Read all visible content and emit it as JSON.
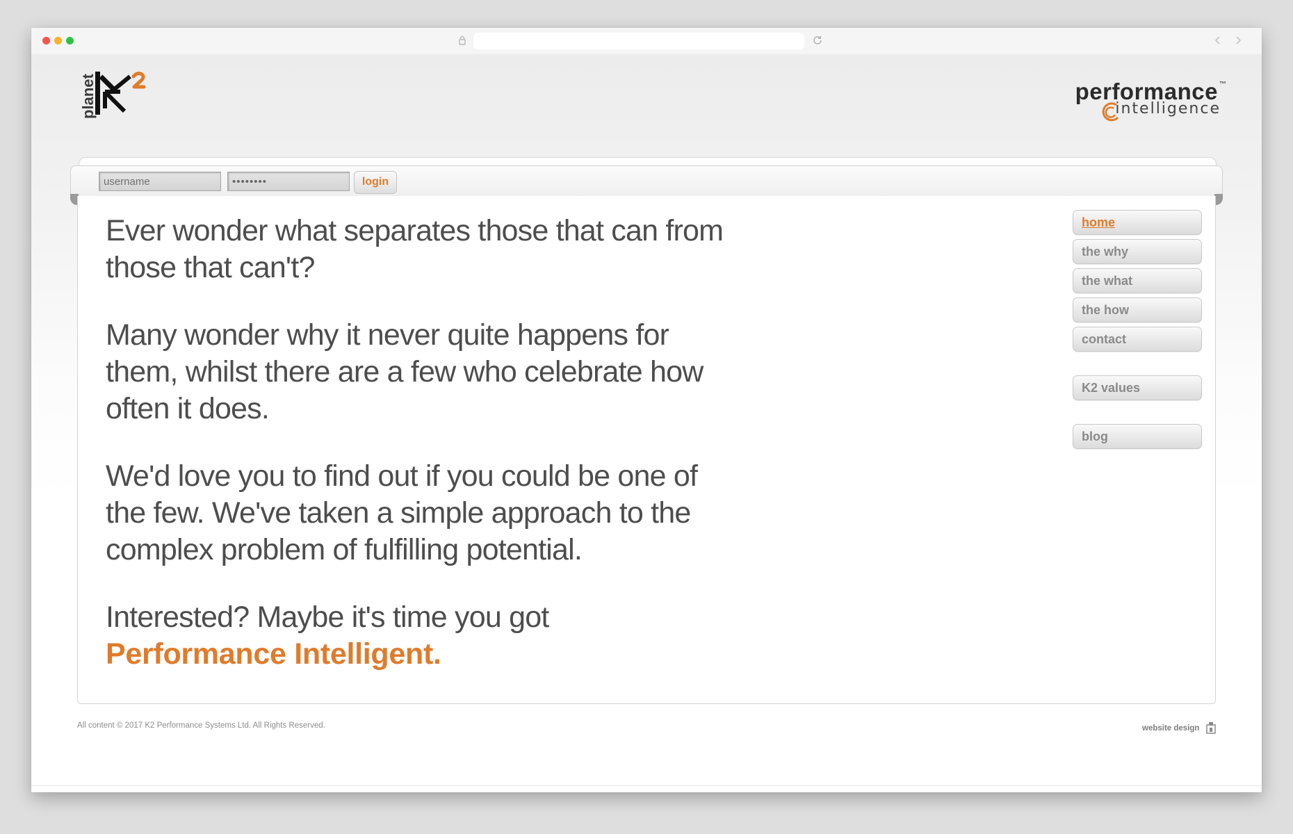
{
  "brand": {
    "left_logo_text": "planet",
    "right_logo_top": "performance",
    "right_logo_tm": "™",
    "right_logo_bottom": "intelligence",
    "accent_color": "#e07b2b"
  },
  "login": {
    "username_placeholder": "username",
    "password_value": "••••••••",
    "button_label": "login"
  },
  "main": {
    "paragraphs": [
      "Ever wonder what separates those that can from those that can't?",
      "Many wonder why it never quite happens for them, whilst there are a few who celebrate how often it does.",
      "We'd love you to find out if you could be one of the few. We've taken a simple approach to the complex problem of fulfilling potential.",
      "Interested? Maybe it's time you got"
    ],
    "highlight": "Performance Intelligent."
  },
  "nav": {
    "items": [
      {
        "label": "home",
        "active": true
      },
      {
        "label": "the why",
        "active": false
      },
      {
        "label": "the what",
        "active": false
      },
      {
        "label": "the how",
        "active": false
      },
      {
        "label": "contact",
        "active": false
      },
      {
        "label": "K2 values",
        "active": false
      },
      {
        "label": "blog",
        "active": false
      }
    ]
  },
  "footer": {
    "copyright": "All content © 2017 K2 Performance Systems Ltd. All Rights Reserved.",
    "design_credit": "website design"
  },
  "icons": {
    "window_controls": [
      "close-dot",
      "minimize-dot",
      "zoom-dot"
    ],
    "toolbar": [
      "lock-icon",
      "reload-icon",
      "back-arrow-icon",
      "forward-arrow-icon"
    ]
  }
}
